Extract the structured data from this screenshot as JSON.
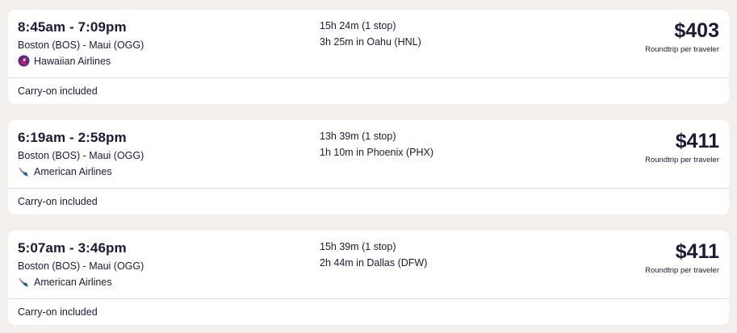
{
  "flights": [
    {
      "times": "8:45am - 7:09pm",
      "route": "Boston (BOS) - Maui (OGG)",
      "airline": "Hawaiian Airlines",
      "airline_icon": "hawaiian-airlines-logo",
      "duration": "15h 24m (1 stop)",
      "layover": "3h 25m in Oahu (HNL)",
      "price": "$403",
      "price_note": "Roundtrip per traveler",
      "baggage": "Carry-on included"
    },
    {
      "times": "6:19am - 2:58pm",
      "route": "Boston (BOS) - Maui (OGG)",
      "airline": "American Airlines",
      "airline_icon": "american-airlines-logo",
      "duration": "13h 39m (1 stop)",
      "layover": "1h 10m in Phoenix (PHX)",
      "price": "$411",
      "price_note": "Roundtrip per traveler",
      "baggage": "Carry-on included"
    },
    {
      "times": "5:07am - 3:46pm",
      "route": "Boston (BOS) - Maui (OGG)",
      "airline": "American Airlines",
      "airline_icon": "american-airlines-logo",
      "duration": "15h 39m (1 stop)",
      "layover": "2h 44m in Dallas (DFW)",
      "price": "$411",
      "price_note": "Roundtrip per traveler",
      "baggage": "Carry-on included"
    }
  ],
  "colors": {
    "page_background": "#f3efec",
    "card_background": "#ffffff",
    "text": "#1a1a33",
    "divider": "#dcdcdc"
  }
}
